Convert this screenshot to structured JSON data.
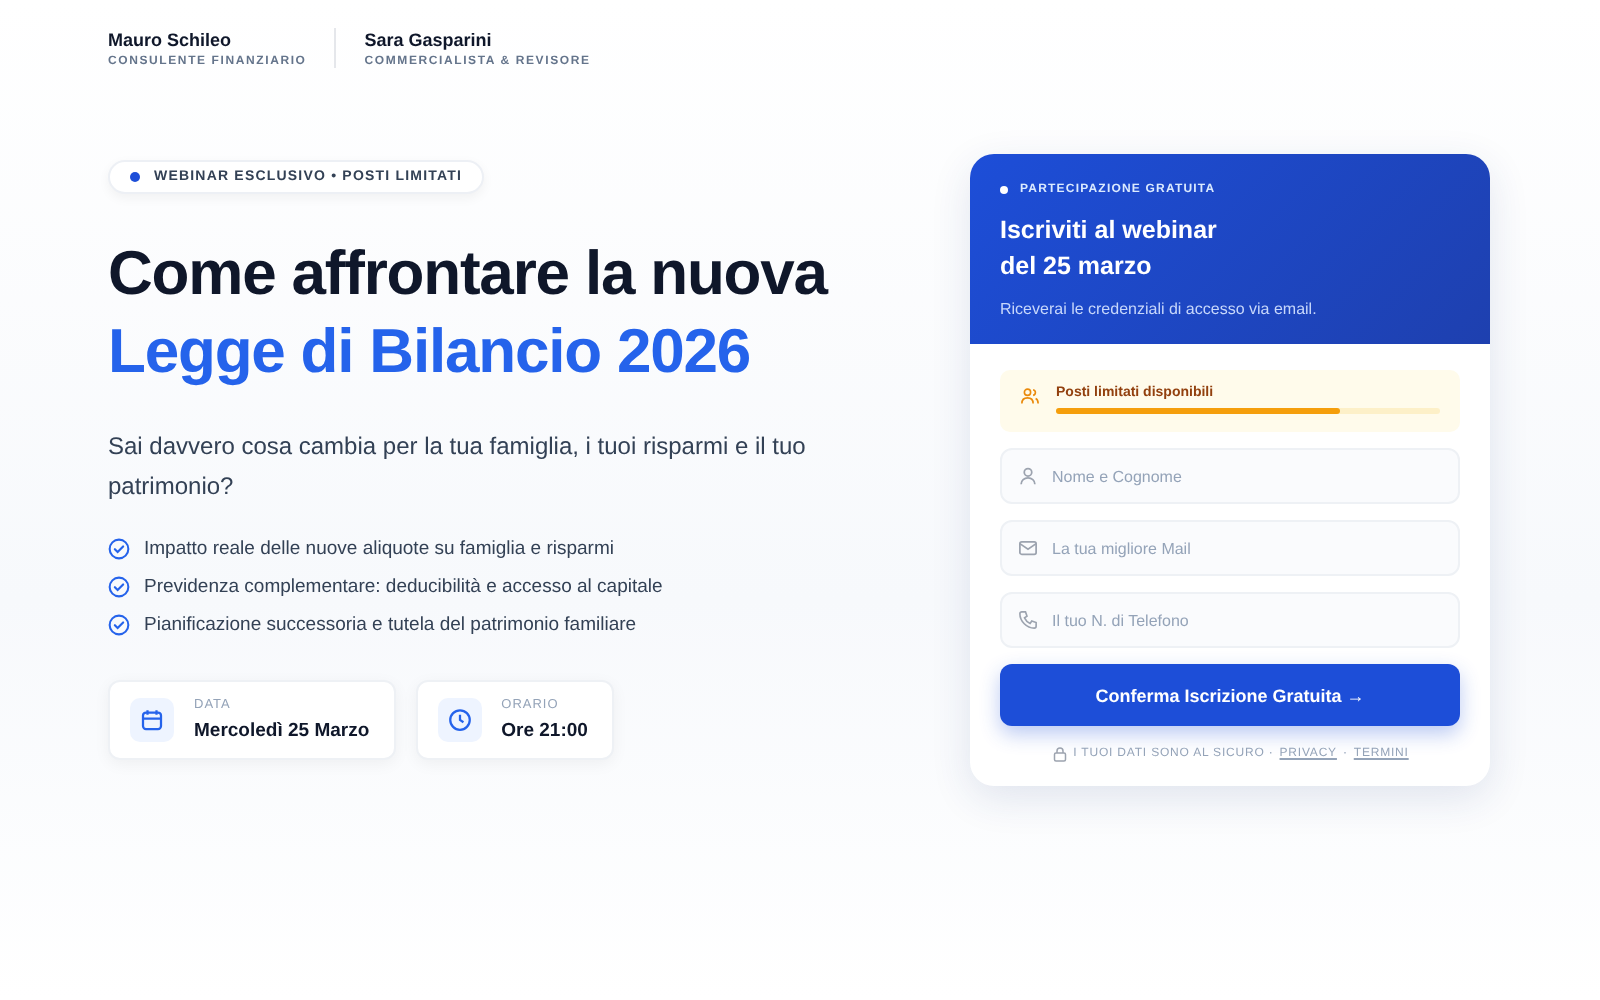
{
  "hosts": [
    {
      "name": "Mauro Schileo",
      "role": "CONSULENTE FINANZIARIO"
    },
    {
      "name": "Sara Gasparini",
      "role": "COMMERCIALISTA & REVISORE"
    }
  ],
  "badge": "WEBINAR ESCLUSIVO • POSTI LIMITATI",
  "headline": {
    "line_1": "Come affrontare la nuova",
    "line_2": "Legge di Bilancio 2026"
  },
  "subtitle": "Sai davvero cosa cambia per la tua famiglia, i tuoi risparmi e il tuo patrimonio?",
  "bullets": [
    "Impatto reale delle nuove aliquote su famiglia e risparmi",
    "Previdenza complementare: deducibilità e accesso al capitale",
    "Pianificazione successoria e tutela del patrimonio familiare"
  ],
  "info_cards": [
    {
      "kind": "date",
      "label": "DATA",
      "value": "Mercoledì 25 Marzo"
    },
    {
      "kind": "time",
      "label": "ORARIO",
      "value": "Ore 21:00"
    }
  ],
  "form": {
    "eyebrow": "PARTECIPAZIONE GRATUITA",
    "title_line_1": "Iscriviti al webinar",
    "title_line_2": "del 25 marzo",
    "note": "Riceverai le credenziali di accesso via email.",
    "availability": {
      "label": "Posti limitati disponibili",
      "level": 0.74
    },
    "fields": [
      {
        "kind": "person",
        "placeholder": "Nome e Cognome"
      },
      {
        "kind": "mail",
        "placeholder": "La tua migliore Mail"
      },
      {
        "kind": "phone",
        "placeholder": "Il tuo N. di Telefono"
      }
    ],
    "submit": "Conferma Iscrizione Gratuita",
    "submit_arrow": "→",
    "privacy_note": "I TUOI DATI SONO AL SICURO ·",
    "privacy_link": "PRIVACY",
    "separator": "·",
    "terms_link": "TERMINI"
  }
}
